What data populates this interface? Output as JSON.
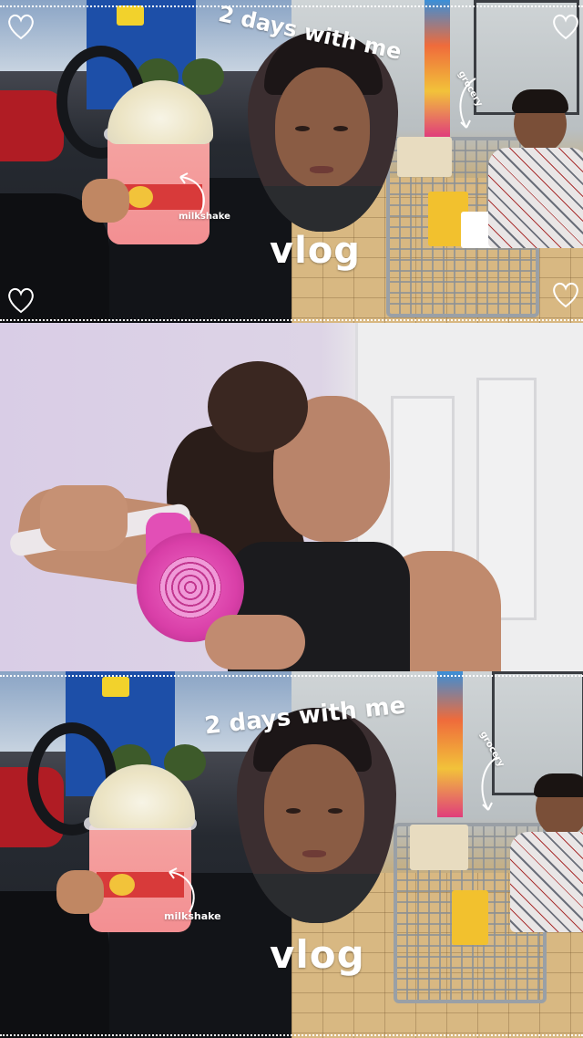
{
  "panels": [
    {
      "id": "top",
      "caption": "2 days with me",
      "title": "vlog",
      "labels": {
        "drink": "milkshake",
        "cart": "grocery"
      }
    },
    {
      "id": "middle"
    },
    {
      "id": "bottom",
      "caption": "2 days with me",
      "title": "vlog",
      "labels": {
        "drink": "milkshake",
        "cart": "grocery"
      }
    }
  ],
  "colors": {
    "text": "#ffffff",
    "milkshake_cup": "#f4a3a1",
    "hair_dryer": "#d93fa8",
    "store_sign": "#1d4fa8"
  },
  "icons": [
    "heart-outline-icon",
    "curved-arrow-icon"
  ]
}
